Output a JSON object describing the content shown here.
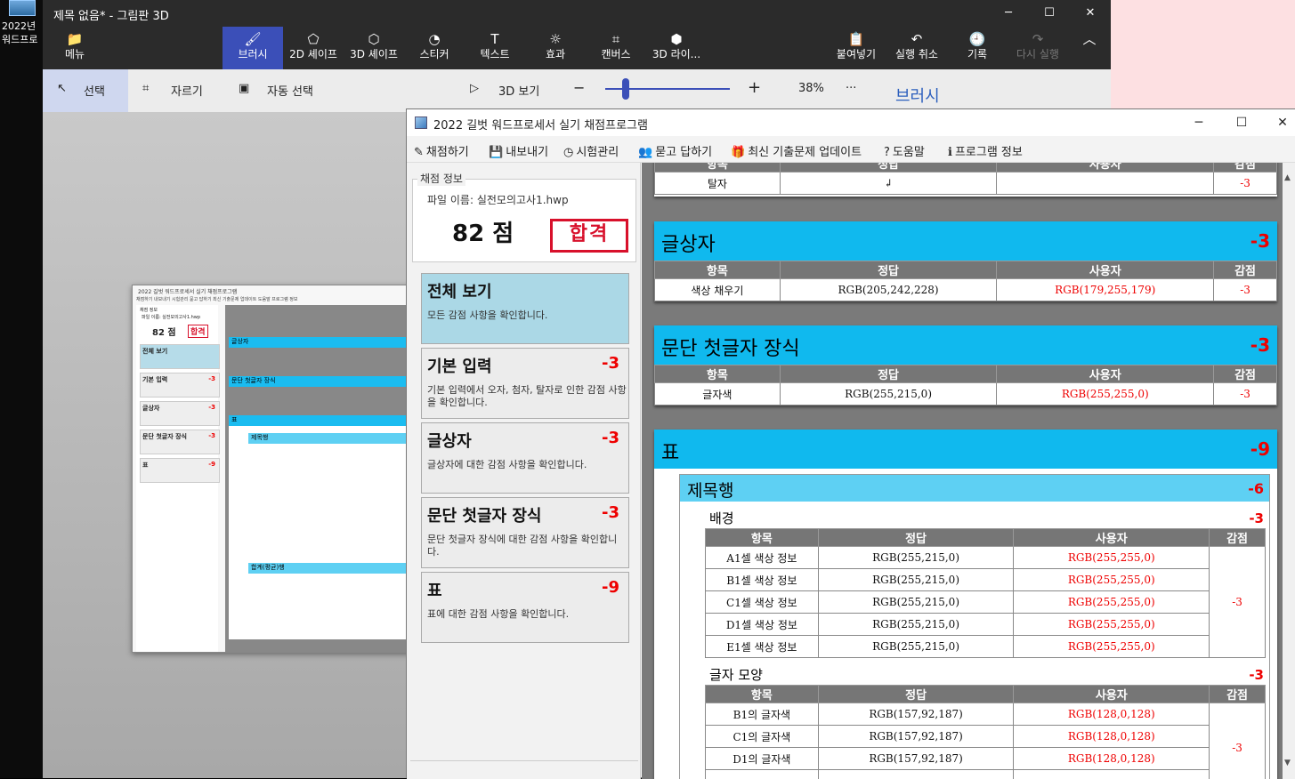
{
  "desktop": {
    "icon_label": "2022년\n워드프로"
  },
  "paint3d": {
    "title": "제목 없음* - 그림판 3D",
    "window_controls": {
      "minimize": "─",
      "maximize": "☐",
      "close": "✕"
    },
    "ribbon": [
      {
        "label": "메뉴",
        "icon": "📁"
      },
      {
        "label": "브러시",
        "icon": "🖌"
      },
      {
        "label": "2D 셰이프",
        "icon": "⬠"
      },
      {
        "label": "3D 셰이프",
        "icon": "⬡"
      },
      {
        "label": "스티커",
        "icon": "◔"
      },
      {
        "label": "텍스트",
        "icon": "T"
      },
      {
        "label": "효과",
        "icon": "☼"
      },
      {
        "label": "캔버스",
        "icon": "⌗"
      },
      {
        "label": "3D 라이...",
        "icon": "⬢"
      },
      {
        "label": "붙여넣기",
        "icon": "📋"
      },
      {
        "label": "실행 취소",
        "icon": "↶"
      },
      {
        "label": "기록",
        "icon": "🕘"
      },
      {
        "label": "다시 실행",
        "icon": "↷"
      },
      {
        "label": "",
        "icon": "︿"
      }
    ],
    "toolbar": {
      "select": "선택",
      "crop": "자르기",
      "magic_select": "자동 선택",
      "view3d": "3D 보기",
      "zoom_minus": "−",
      "zoom_plus": "+",
      "zoom": "38%",
      "more": "···",
      "panel_title": "브러시"
    }
  },
  "grading": {
    "title": "2022 길벗 워드프로세서 실기 채점프로그램",
    "window_controls": {
      "minimize": "─",
      "maximize": "☐",
      "close": "✕"
    },
    "menu": [
      {
        "label": "채점하기",
        "icon": "✎"
      },
      {
        "label": "내보내기",
        "icon": "💾"
      },
      {
        "label": "시험관리",
        "icon": "◷"
      },
      {
        "label": "묻고 답하기",
        "icon": "👥"
      },
      {
        "label": "최신 기출문제 업데이트",
        "icon": "🎁"
      },
      {
        "label": "도움말",
        "icon": "?"
      },
      {
        "label": "프로그램 정보",
        "icon": "ℹ"
      }
    ],
    "info": {
      "legend": "채점 정보",
      "file": "파일 이름: 실전모의고사1.hwp",
      "score": "82 점",
      "stamp": "합격"
    },
    "cards": [
      {
        "title": "전체 보기",
        "deduct": "",
        "desc": "모든 감점 사항을 확인합니다."
      },
      {
        "title": "기본 입력",
        "deduct": "-3",
        "desc": "기본 입력에서 오자, 첨자, 탈자로 인한 감점 사항을 확인합니다."
      },
      {
        "title": "글상자",
        "deduct": "-3",
        "desc": "글상자에 대한 감점 사항을 확인합니다."
      },
      {
        "title": "문단 첫글자 장식",
        "deduct": "-3",
        "desc": "문단 첫글자 장식에 대한 감점 사항을 확인합니다."
      },
      {
        "title": "표",
        "deduct": "-9",
        "desc": "표에 대한 감점 사항을 확인합니다."
      }
    ],
    "headers": {
      "item": "항목",
      "answer": "정답",
      "user": "사용자",
      "deduct": "감점"
    },
    "top_row": {
      "item": "탈자",
      "answer": "↲",
      "user": "",
      "deduct": "-3"
    },
    "textbox": {
      "title": "글상자",
      "deduct": "-3",
      "row": {
        "item": "색상 채우기",
        "answer": "RGB(205,242,228)",
        "user": "RGB(179,255,179)",
        "deduct": "-3"
      }
    },
    "dropcap": {
      "title": "문단 첫글자 장식",
      "deduct": "-3",
      "row": {
        "item": "글자색",
        "answer": "RGB(255,215,0)",
        "user": "RGB(255,255,0)",
        "deduct": "-3"
      }
    },
    "table": {
      "title": "표",
      "deduct": "-9",
      "sub_title": "제목행",
      "sub_deduct": "-6",
      "bg": {
        "title": "배경",
        "deduct": "-3",
        "merged_deduct": "-3",
        "rows": [
          {
            "item": "A1셀 색상 정보",
            "answer": "RGB(255,215,0)",
            "user": "RGB(255,255,0)"
          },
          {
            "item": "B1셀 색상 정보",
            "answer": "RGB(255,215,0)",
            "user": "RGB(255,255,0)"
          },
          {
            "item": "C1셀 색상 정보",
            "answer": "RGB(255,215,0)",
            "user": "RGB(255,255,0)"
          },
          {
            "item": "D1셀 색상 정보",
            "answer": "RGB(255,215,0)",
            "user": "RGB(255,255,0)"
          },
          {
            "item": "E1셀 색상 정보",
            "answer": "RGB(255,215,0)",
            "user": "RGB(255,255,0)"
          }
        ]
      },
      "font": {
        "title": "글자 모양",
        "deduct": "-3",
        "merged_deduct": "-3",
        "rows": [
          {
            "item": "B1의 글자색",
            "answer": "RGB(157,92,187)",
            "user": "RGB(128,0,128)"
          },
          {
            "item": "C1의 글자색",
            "answer": "RGB(157,92,187)",
            "user": "RGB(128,0,128)"
          },
          {
            "item": "D1의 글자색",
            "answer": "RGB(157,92,187)",
            "user": "RGB(128,0,128)"
          }
        ]
      }
    }
  },
  "thumbnail": {
    "title": "2022 길벗 워드프로세서 실기 채점프로그램",
    "menu": "채점하기  내보내기  시험관리  묻고 답하기  최신 기출문제 업데이트  도움말  프로그램 정보",
    "legend": "채점 정보",
    "file": "파일 이름: 실전모의고사1.hwp",
    "score": "82 점",
    "stamp": "합격",
    "cards": [
      {
        "title": "전체 보기",
        "deduct": ""
      },
      {
        "title": "기본 입력",
        "deduct": "-3"
      },
      {
        "title": "글상자",
        "deduct": "-3"
      },
      {
        "title": "문단 첫글자 장식",
        "deduct": "-3"
      },
      {
        "title": "표",
        "deduct": "-9"
      }
    ],
    "sections": [
      "글상자",
      "문단 첫글자 장식",
      "표"
    ],
    "subsections": [
      "제목행",
      "합계(평균)행"
    ]
  },
  "colors": {
    "accent": "#3b4fb8",
    "cyan": "#10b9ee",
    "light_cyan": "#5ed0f3",
    "deduct": "#e00000",
    "stamp": "#d8102b"
  }
}
